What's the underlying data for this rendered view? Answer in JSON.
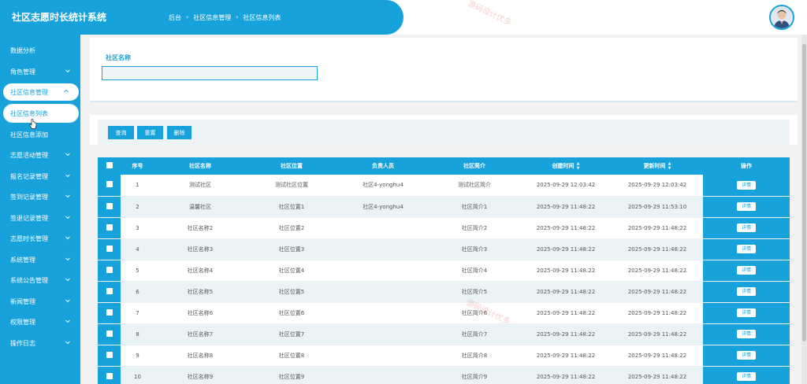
{
  "header": {
    "app_title": "社区志愿时长统计系统",
    "breadcrumb": [
      "后台",
      "社区信息管理",
      "社区信息列表"
    ]
  },
  "sidebar": {
    "items": [
      {
        "label": "数据分析",
        "has_chevron": false
      },
      {
        "label": "角色管理",
        "has_chevron": true
      },
      {
        "label": "社区信息管理",
        "has_chevron": true,
        "active": true
      },
      {
        "label": "社区信息列表",
        "sub": true,
        "active": true
      },
      {
        "label": "社区信息添加",
        "sub": true
      },
      {
        "label": "志愿活动管理",
        "has_chevron": true
      },
      {
        "label": "报名记录管理",
        "has_chevron": true
      },
      {
        "label": "签到记录管理",
        "has_chevron": true
      },
      {
        "label": "签退记录管理",
        "has_chevron": true
      },
      {
        "label": "志愿时长管理",
        "has_chevron": true
      },
      {
        "label": "系统管理",
        "has_chevron": true
      },
      {
        "label": "系统公告管理",
        "has_chevron": true
      },
      {
        "label": "新闻管理",
        "has_chevron": true
      },
      {
        "label": "权限管理",
        "has_chevron": true
      },
      {
        "label": "操作日志",
        "has_chevron": true
      }
    ]
  },
  "search": {
    "label": "社区名称",
    "value": "",
    "placeholder": ""
  },
  "actions": {
    "query": "查询",
    "reset": "重置",
    "delete": "删除"
  },
  "table": {
    "columns": [
      "序号",
      "社区名称",
      "社区位置",
      "负责人员",
      "社区简介",
      "创建时间",
      "更新时间",
      "操作"
    ],
    "sortable_columns": [
      "创建时间",
      "更新时间"
    ],
    "detail_label": "详情",
    "rows": [
      {
        "no": "1",
        "name": "测试社区",
        "location": "测试社区位置",
        "manager": "社区4-yonghu4",
        "intro": "测试社区简介",
        "created": "2025-09-29 12:03:42",
        "updated": "2025-09-29 12:03:42"
      },
      {
        "no": "2",
        "name": "温馨社区",
        "location": "社区位置1",
        "manager": "社区4-yonghu4",
        "intro": "社区简介1",
        "created": "2025-09-29 11:48:22",
        "updated": "2025-09-29 11:53:10"
      },
      {
        "no": "3",
        "name": "社区名称2",
        "location": "社区位置2",
        "manager": "",
        "intro": "社区简介2",
        "created": "2025-09-29 11:48:22",
        "updated": "2025-09-29 11:48:22"
      },
      {
        "no": "4",
        "name": "社区名称3",
        "location": "社区位置3",
        "manager": "",
        "intro": "社区简介3",
        "created": "2025-09-29 11:48:22",
        "updated": "2025-09-29 11:48:22"
      },
      {
        "no": "5",
        "name": "社区名称4",
        "location": "社区位置4",
        "manager": "",
        "intro": "社区简介4",
        "created": "2025-09-29 11:48:22",
        "updated": "2025-09-29 11:48:22"
      },
      {
        "no": "6",
        "name": "社区名称5",
        "location": "社区位置5",
        "manager": "",
        "intro": "社区简介5",
        "created": "2025-09-29 11:48:22",
        "updated": "2025-09-29 11:48:22"
      },
      {
        "no": "7",
        "name": "社区名称6",
        "location": "社区位置6",
        "manager": "",
        "intro": "社区简介6",
        "created": "2025-09-29 11:48:22",
        "updated": "2025-09-29 11:48:22"
      },
      {
        "no": "8",
        "name": "社区名称7",
        "location": "社区位置7",
        "manager": "",
        "intro": "社区简介7",
        "created": "2025-09-29 11:48:22",
        "updated": "2025-09-29 11:48:22"
      },
      {
        "no": "9",
        "name": "社区名称8",
        "location": "社区位置8",
        "manager": "",
        "intro": "社区简介8",
        "created": "2025-09-29 11:48:22",
        "updated": "2025-09-29 11:48:22"
      },
      {
        "no": "10",
        "name": "社区名称9",
        "location": "社区位置9",
        "manager": "",
        "intro": "社区简介9",
        "created": "2025-09-29 11:48:22",
        "updated": "2025-09-29 11:48:22"
      }
    ]
  },
  "colors": {
    "primary": "#17a2db",
    "row_alt": "#eaf4f7"
  }
}
